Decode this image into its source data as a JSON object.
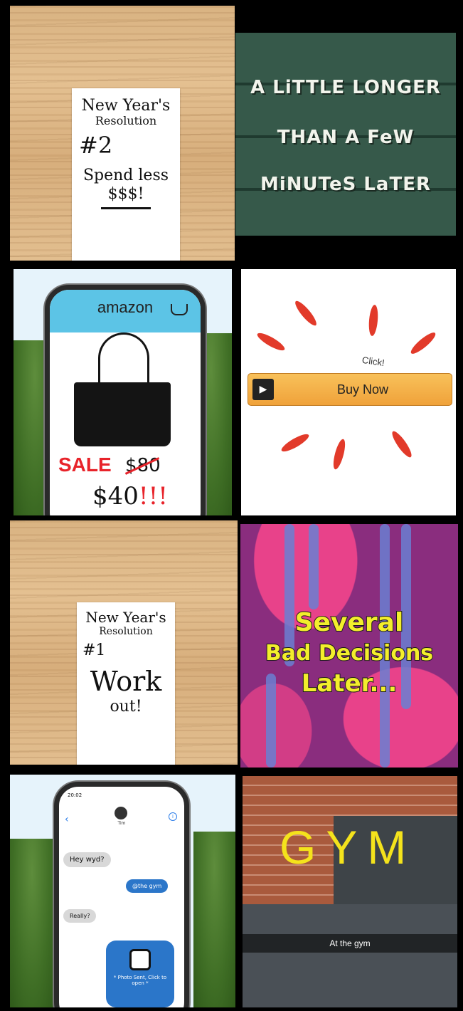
{
  "panel1": {
    "note_lines": [
      "New Year's",
      "Resolution",
      "#2",
      "Spend less",
      "$$$!"
    ]
  },
  "panel2": {
    "title_lines": [
      "A LiTTLE LONGER",
      "THAN A FeW",
      "MiNUTeS LaTER"
    ]
  },
  "panel3": {
    "brand": "amazon",
    "sale": "SALE",
    "old_price": "$80",
    "new_price": "$40",
    "exclaim": "!!!"
  },
  "panel4": {
    "click": "Click!",
    "button_label": "Buy Now"
  },
  "panel5": {
    "note_lines": [
      "New Year's",
      "Resolution",
      "#1",
      "Work",
      "out!"
    ]
  },
  "panel6": {
    "title_lines": [
      "Several",
      "Bad Decisions",
      "Later..."
    ]
  },
  "panel7": {
    "status_time": "20:02",
    "contact": "Tim",
    "messages": [
      "Hey wyd?",
      "@the gym",
      "Really?",
      "* Photo Sent, Click to open *"
    ]
  },
  "panel8": {
    "sign": "GYM",
    "caption": "At the gym"
  },
  "colors": {
    "amazon_blue": "#5cc4e6",
    "sale_red": "#e8232a",
    "buy_orange": "#f0a23a",
    "sponge_yellow": "#f3ee2c"
  }
}
